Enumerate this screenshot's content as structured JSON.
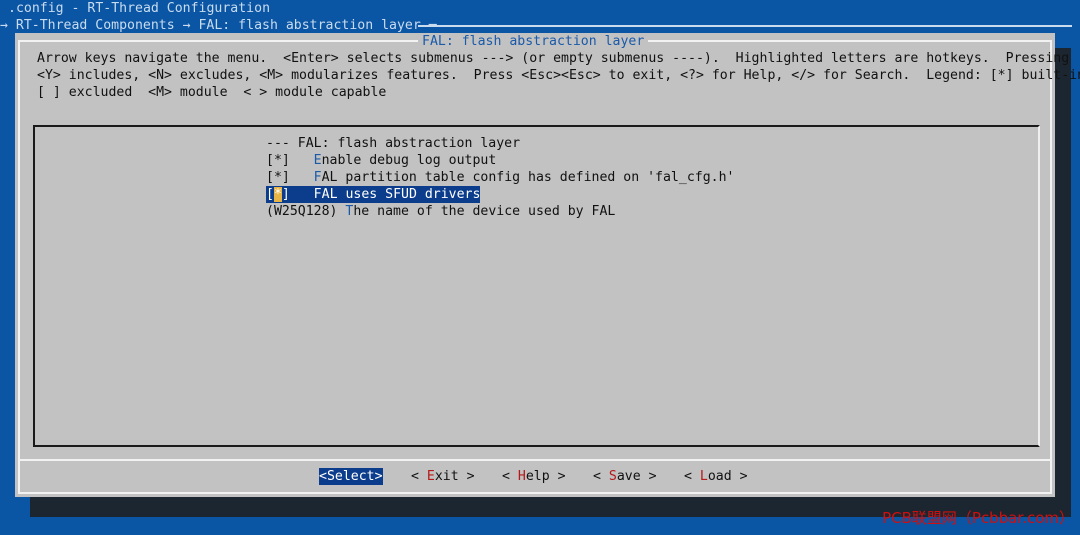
{
  "header": {
    "title": ".config - RT-Thread Configuration",
    "breadcrumb": "→ RT-Thread Components → FAL: flash abstraction layer ─"
  },
  "dialog": {
    "title": "FAL: flash abstraction layer",
    "help_lines": [
      "Arrow keys navigate the menu.  <Enter> selects submenus ---> (or empty submenus ----).  Highlighted letters are hotkeys.  Pressing",
      "<Y> includes, <N> excludes, <M> modularizes features.  Press <Esc><Esc> to exit, <?> for Help, </> for Search.  Legend: [*] built-in",
      "[ ] excluded  <M> module  < > module capable"
    ]
  },
  "menu": {
    "header": "--- FAL: flash abstraction layer",
    "items": [
      {
        "prefix": "[*]   ",
        "hotkey": "E",
        "rest": "nable debug log output"
      },
      {
        "prefix": "[*]   ",
        "hotkey": "F",
        "rest": "AL partition table config has defined on 'fal_cfg.h'"
      },
      {
        "bracket_open": "[",
        "cursor": "*",
        "bracket_close": "]   ",
        "hotkey": "F",
        "rest": "AL uses SFUD drivers"
      },
      {
        "prefix": "(W25Q128) ",
        "hotkey": "T",
        "rest": "he name of the device used by FAL"
      }
    ]
  },
  "buttons": {
    "select": "<Select>",
    "exit": {
      "open": "< ",
      "hotkey": "E",
      "rest": "xit >"
    },
    "help": {
      "open": "< ",
      "hotkey": "H",
      "rest": "elp >"
    },
    "save": {
      "open": "< ",
      "hotkey": "S",
      "rest": "ave >"
    },
    "load": {
      "open": "< ",
      "hotkey": "L",
      "rest": "oad >"
    }
  },
  "watermark": "PCB联盟网（Pcbbar.com）"
}
